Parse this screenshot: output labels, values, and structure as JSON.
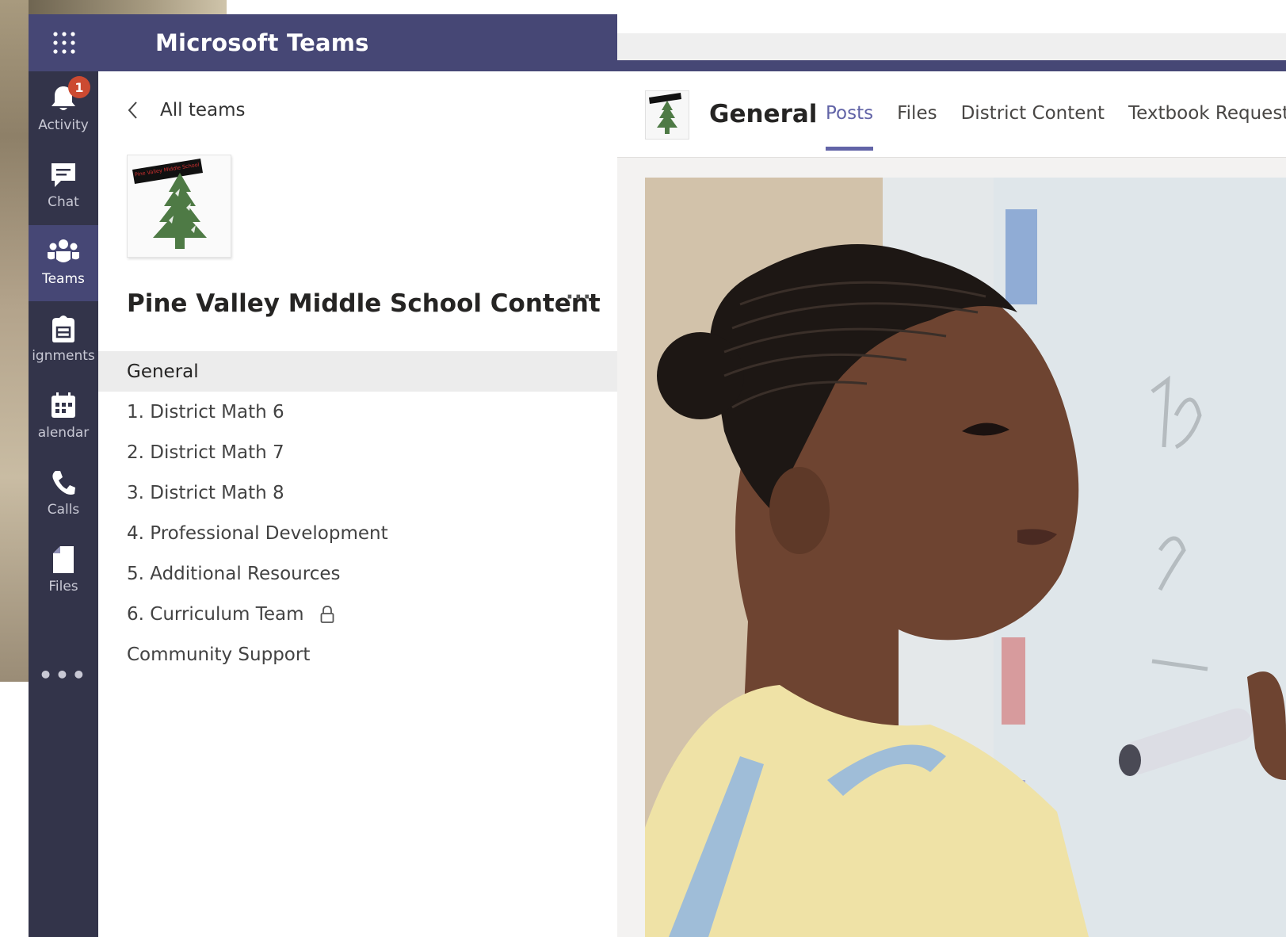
{
  "app": {
    "title": "Microsoft Teams"
  },
  "rail": {
    "items": [
      {
        "label": "Activity",
        "icon": "bell-icon",
        "badge": "1"
      },
      {
        "label": "Chat",
        "icon": "chat-icon"
      },
      {
        "label": "Teams",
        "icon": "teams-icon",
        "active": true
      },
      {
        "label": "ignments",
        "icon": "assignments-icon"
      },
      {
        "label": "alendar",
        "icon": "calendar-icon"
      },
      {
        "label": "Calls",
        "icon": "phone-icon"
      },
      {
        "label": "Files",
        "icon": "file-icon"
      }
    ],
    "more": "•••"
  },
  "panel": {
    "back_label": "All teams",
    "team_name": "Pine Valley Middle School Content",
    "team_more": "···",
    "logo_banner_text": "Pine Valley Middle School",
    "channels": [
      {
        "label": "General",
        "active": true
      },
      {
        "label": "1. District Math 6"
      },
      {
        "label": "2. District Math 7"
      },
      {
        "label": "3. District Math 8"
      },
      {
        "label": "4. Professional Development"
      },
      {
        "label": "5. Additional Resources"
      },
      {
        "label": "6. Curriculum Team",
        "private": true
      },
      {
        "label": "Community Support"
      }
    ]
  },
  "channel": {
    "title": "General",
    "tabs": [
      {
        "label": "Posts",
        "active": true
      },
      {
        "label": "Files"
      },
      {
        "label": "District Content"
      },
      {
        "label": "Textbook Request"
      }
    ]
  },
  "colors": {
    "titlebar": "#464775",
    "rail": "#33344a",
    "accent": "#6264a7",
    "badge": "#cc4a31",
    "tree": "#4e7a45"
  }
}
